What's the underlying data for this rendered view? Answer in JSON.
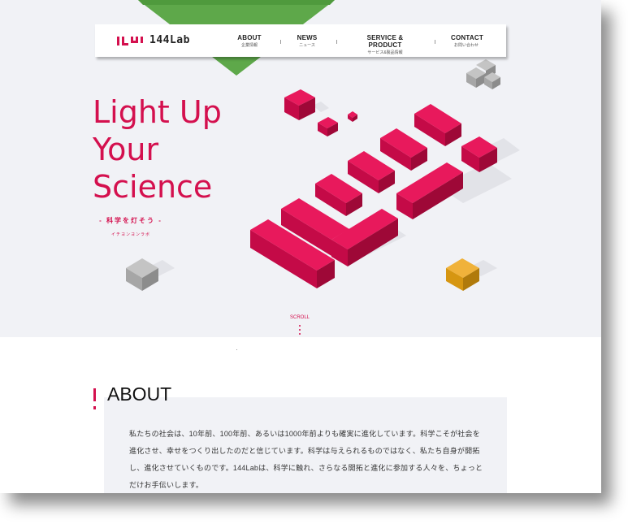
{
  "logo": {
    "mark": "1⁴⁴",
    "text": "144Lab"
  },
  "nav": [
    {
      "label": "ABOUT",
      "sub": "企業情報"
    },
    {
      "label": "NEWS",
      "sub": "ニュース"
    },
    {
      "label": "SERVICE & PRODUCT",
      "sub": "サービス&製品情報"
    },
    {
      "label": "CONTACT",
      "sub": "お問い合わせ"
    }
  ],
  "hero": {
    "headline": [
      "Light Up",
      "Your",
      "Science"
    ],
    "tagline": "- 科学を灯そう -",
    "kana": "イチヨンヨンラボ",
    "scroll": "SCROLL"
  },
  "about": {
    "title": "ABOUT",
    "body": "私たちの社会は、10年前、100年前、あるいは1000年前よりも確実に進化しています。科学こそが社会を進化させ、幸せをつくり出したのだと信じています。科学は与えられるものではなく、私たち自身が開拓し、進化させていくものです。144Labは、科学に触れ、さらなる開拓と進化に参加する人々を、ちょっとだけお手伝いします。"
  },
  "colors": {
    "brand": "#d4104e",
    "green": "#5ea84a",
    "gray_cube": "#a9a9a9",
    "gold_cube": "#e0a11f",
    "hero_bg": "#f1f2f6"
  },
  "icons": [
    "logo-mark-icon",
    "green-triangle-decoration",
    "gray-cube-icon",
    "gold-cube-icon"
  ]
}
